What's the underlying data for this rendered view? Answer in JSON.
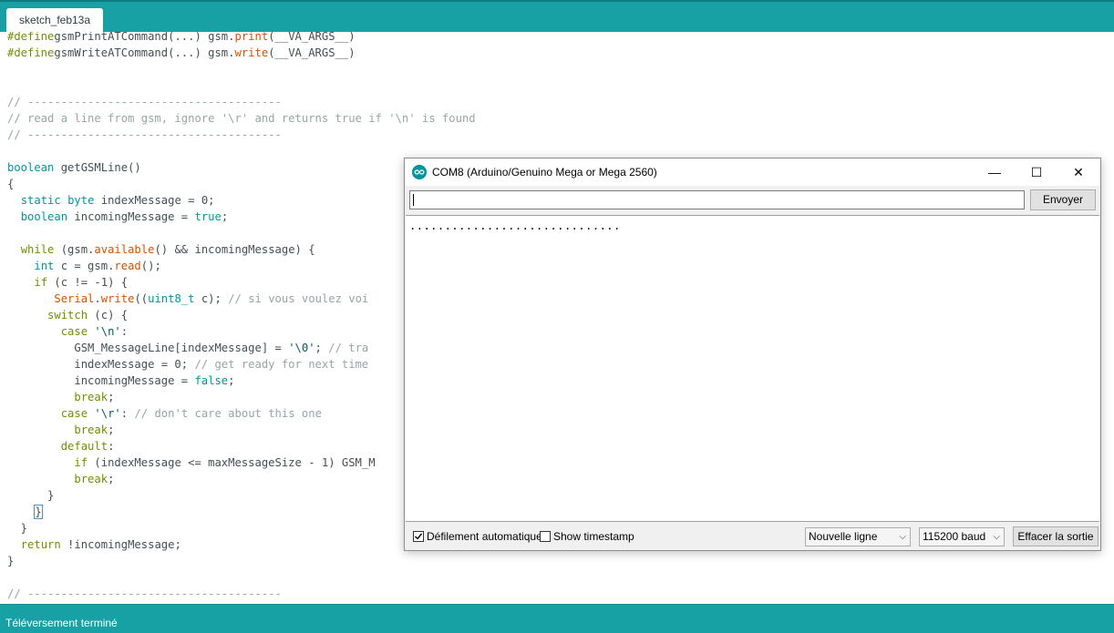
{
  "tab": {
    "label": "sketch_feb13a"
  },
  "code": [
    [
      [
        "pp",
        "#define"
      ],
      [
        "",
        "gsmPrintATCommand(...) gsm."
      ],
      [
        "fn",
        "print"
      ],
      [
        "",
        "(__VA_ARGS__)"
      ]
    ],
    [
      [
        "pp",
        "#define"
      ],
      [
        "",
        "gsmWriteATCommand(...) gsm."
      ],
      [
        "fn",
        "write"
      ],
      [
        "",
        "(__VA_ARGS__)"
      ]
    ],
    [],
    [],
    [
      [
        "cm",
        "// --------------------------------------"
      ]
    ],
    [
      [
        "cm",
        "// read a line from gsm, ignore '\\r' and returns true if '\\n' is found"
      ]
    ],
    [
      [
        "cm",
        "// --------------------------------------"
      ]
    ],
    [],
    [
      [
        "type",
        "boolean"
      ],
      [
        "",
        " getGSMLine()"
      ]
    ],
    [
      [
        "",
        "{"
      ]
    ],
    [
      [
        "",
        "  "
      ],
      [
        "type",
        "static"
      ],
      [
        "",
        " "
      ],
      [
        "type",
        "byte"
      ],
      [
        "",
        " indexMessage = 0;"
      ]
    ],
    [
      [
        "",
        "  "
      ],
      [
        "type",
        "boolean"
      ],
      [
        "",
        " incomingMessage = "
      ],
      [
        "type",
        "true"
      ],
      [
        "",
        ";"
      ]
    ],
    [],
    [
      [
        "",
        "  "
      ],
      [
        "ctl",
        "while"
      ],
      [
        "",
        " (gsm."
      ],
      [
        "fn",
        "available"
      ],
      [
        "",
        "() && incomingMessage) {"
      ]
    ],
    [
      [
        "",
        "    "
      ],
      [
        "type",
        "int"
      ],
      [
        "",
        " c = gsm."
      ],
      [
        "fn",
        "read"
      ],
      [
        "",
        "();"
      ]
    ],
    [
      [
        "",
        "    "
      ],
      [
        "ctl",
        "if"
      ],
      [
        "",
        " (c != -1) {"
      ]
    ],
    [
      [
        "",
        "       "
      ],
      [
        "fn",
        "Serial"
      ],
      [
        "",
        "."
      ],
      [
        "fn",
        "write"
      ],
      [
        "",
        "(("
      ],
      [
        "type",
        "uint8_t"
      ],
      [
        "",
        " c); "
      ],
      [
        "cm",
        "// si vous voulez voi"
      ]
    ],
    [
      [
        "",
        "      "
      ],
      [
        "ctl",
        "switch"
      ],
      [
        "",
        " (c) {"
      ]
    ],
    [
      [
        "",
        "        "
      ],
      [
        "ctl",
        "case"
      ],
      [
        "",
        " "
      ],
      [
        "st",
        "'\\n'"
      ],
      [
        "",
        ":"
      ]
    ],
    [
      [
        "",
        "          GSM_MessageLine[indexMessage] = "
      ],
      [
        "st",
        "'\\0'"
      ],
      [
        "",
        "; "
      ],
      [
        "cm",
        "// tra"
      ]
    ],
    [
      [
        "",
        "          indexMessage = 0; "
      ],
      [
        "cm",
        "// get ready for next time"
      ]
    ],
    [
      [
        "",
        "          incomingMessage = "
      ],
      [
        "type",
        "false"
      ],
      [
        "",
        ";"
      ]
    ],
    [
      [
        "",
        "          "
      ],
      [
        "ctl",
        "break"
      ],
      [
        "",
        ";"
      ]
    ],
    [
      [
        "",
        "        "
      ],
      [
        "ctl",
        "case"
      ],
      [
        "",
        " "
      ],
      [
        "st",
        "'\\r'"
      ],
      [
        "",
        ": "
      ],
      [
        "cm",
        "// don't care about this one"
      ]
    ],
    [
      [
        "",
        "          "
      ],
      [
        "ctl",
        "break"
      ],
      [
        "",
        ";"
      ]
    ],
    [
      [
        "",
        "        "
      ],
      [
        "ctl",
        "default"
      ],
      [
        "",
        ":"
      ]
    ],
    [
      [
        "",
        "          "
      ],
      [
        "ctl",
        "if"
      ],
      [
        "",
        " (indexMessage <= maxMessageSize - 1) GSM_M"
      ]
    ],
    [
      [
        "",
        "          "
      ],
      [
        "ctl",
        "break"
      ],
      [
        "",
        ";"
      ]
    ],
    [
      [
        "",
        "      }"
      ]
    ],
    [
      [
        "",
        "    "
      ],
      [
        "box",
        "}"
      ]
    ],
    [
      [
        "",
        "  }"
      ]
    ],
    [
      [
        "",
        "  "
      ],
      [
        "ctl",
        "return"
      ],
      [
        "",
        " !incomingMessage;"
      ]
    ],
    [
      [
        "",
        "}"
      ]
    ],
    [],
    [
      [
        "cm",
        "// --------------------------------------"
      ]
    ]
  ],
  "status": {
    "text": "Téléversement terminé"
  },
  "serial_monitor": {
    "title": "COM8 (Arduino/Genuino Mega or Mega 2560)",
    "send_label": "Envoyer",
    "input_value": "",
    "output": "..............................",
    "autoscroll_label": "Défilement automatique",
    "autoscroll_checked": true,
    "timestamp_label": "Show timestamp",
    "timestamp_checked": false,
    "line_ending": "Nouvelle ligne",
    "baud": "115200 baud",
    "clear_label": "Effacer la sortie",
    "minimize_glyph": "—",
    "maximize_glyph": "☐",
    "close_glyph": "✕",
    "chevron_glyph": "⌵",
    "check_glyph": "✓"
  },
  "colors": {
    "accent": "#17a1a5",
    "keyword_type": "#00979c",
    "keyword_control": "#728e00",
    "function": "#d35400",
    "comment": "#95a5a6"
  }
}
